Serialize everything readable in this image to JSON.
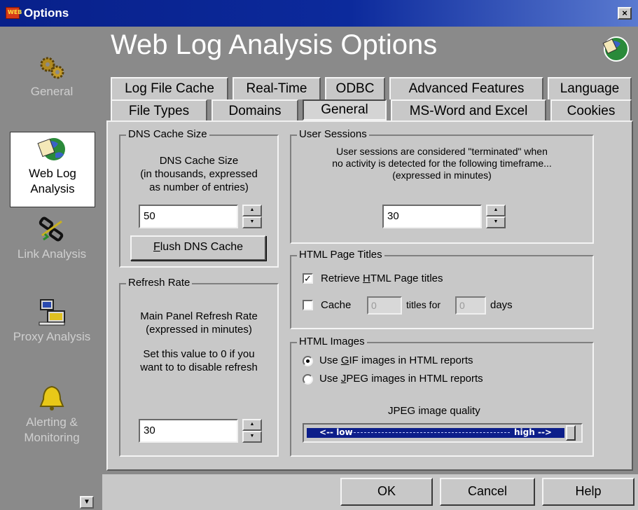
{
  "window": {
    "title": "Options",
    "close_glyph": "×",
    "app_icon_text": "WEB"
  },
  "sidebar": {
    "items": [
      {
        "label": "General",
        "icon": "gears-icon"
      },
      {
        "label": "Web Log Analysis",
        "icon": "globe-document-icon"
      },
      {
        "label": "Link Analysis",
        "icon": "broken-link-icon"
      },
      {
        "label": "Proxy Analysis",
        "icon": "computer-icon"
      },
      {
        "label": "Alerting & Monitoring",
        "icon": "bell-icon"
      }
    ],
    "scroll_glyph": "▼"
  },
  "header": {
    "title": "Web Log Analysis Options"
  },
  "tabs": {
    "row1": [
      "Log File Cache",
      "Real-Time",
      "ODBC",
      "Advanced Features",
      "Language"
    ],
    "row2": [
      "File Types",
      "Domains",
      "General",
      "MS-Word and Excel",
      "Cookies"
    ],
    "selected": "General"
  },
  "dns": {
    "group_title": "DNS Cache Size",
    "line1": "DNS Cache Size",
    "line2": "(in thousands, expressed",
    "line3": "as number of entries)",
    "value": "50",
    "flush_button": "lush DNS Cache",
    "flush_accel": "F"
  },
  "refresh": {
    "group_title": "Refresh Rate",
    "line1": "Main Panel Refresh Rate",
    "line2": "(expressed in minutes)",
    "line3": "Set this value to 0 if you",
    "line4": "want to to disable refresh",
    "value": "30"
  },
  "sessions": {
    "group_title": "User Sessions",
    "line1": "User sessions are considered \"terminated\" when",
    "line2": "no activity is detected for the following timeframe...",
    "line3": "(expressed in minutes)",
    "value": "30"
  },
  "page_titles": {
    "group_title": "HTML Page Titles",
    "retrieve_pre": "Retrieve ",
    "retrieve_accel": "H",
    "retrieve_post": "TML Page titles",
    "retrieve_checked": true,
    "cache_label": "Cache",
    "cache_titles_value": "0",
    "titles_for": "titles for",
    "cache_days_value": "0",
    "days": "days",
    "cache_checked": false
  },
  "images": {
    "group_title": "HTML Images",
    "gif_pre": "Use ",
    "gif_accel": "G",
    "gif_post": "IF images in HTML reports",
    "jpeg_pre": "Use ",
    "jpeg_accel": "J",
    "jpeg_post": "PEG images in HTML reports",
    "selected": "gif",
    "quality_label": "JPEG image quality",
    "low_label": "<-- low",
    "high_label": "high -->",
    "quality_fraction": 1.0
  },
  "buttons": {
    "ok": "OK",
    "cancel": "Cancel",
    "help": "Help"
  },
  "colors": {
    "titlebar": "#0c2a9c",
    "sidebar": "#8a8a8a",
    "slider": "#0c1e8a"
  }
}
